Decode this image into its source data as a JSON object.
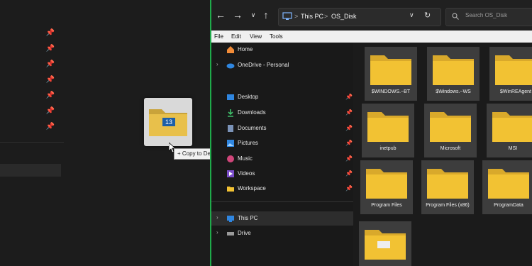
{
  "drag": {
    "item_count": "13",
    "tooltip": "+ Copy to Destination"
  },
  "address": {
    "crumbs": [
      "This PC",
      "OS_Disk"
    ],
    "separator": ">"
  },
  "search": {
    "placeholder": "Search OS_Disk"
  },
  "menu": [
    "File",
    "Edit",
    "View",
    "Tools"
  ],
  "sidebar": {
    "home": "Home",
    "onedrive": "OneDrive - Personal",
    "desktop": "Desktop",
    "downloads": "Downloads",
    "documents": "Documents",
    "pictures": "Pictures",
    "music": "Music",
    "videos": "Videos",
    "workspace": "Workspace",
    "thispc": "This PC",
    "drive": "Drive"
  },
  "folders": [
    "$WINDOWS.~BT",
    "$Windows.~WS",
    "$WinREAgent",
    "inetpub",
    "Microsoft",
    "MSI",
    "Program Files",
    "Program Files (x86)",
    "ProgramData",
    ""
  ],
  "colors": {
    "accent_green": "#1faa4a",
    "folder_yellow": "#f2c233",
    "selection": "#2d2d2d"
  }
}
